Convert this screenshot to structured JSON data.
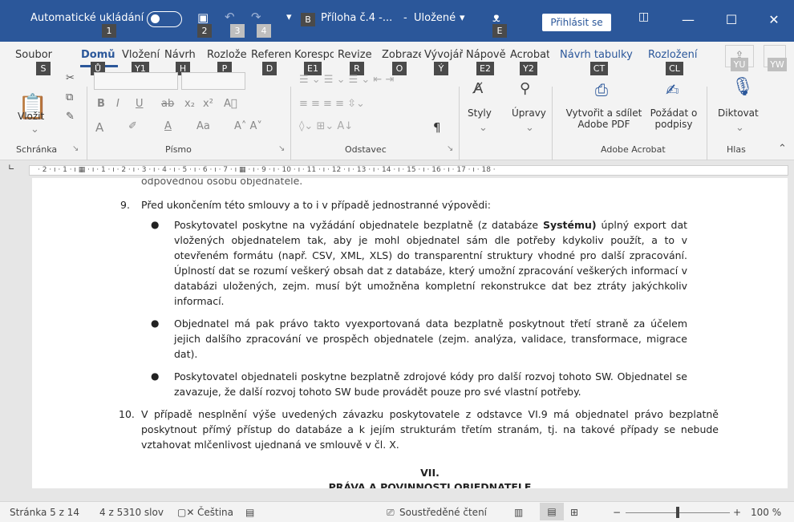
{
  "titlebar": {
    "autosave_label": "Automatické ukládání",
    "filename": "Příloha č.4 -...",
    "saved_status": "Uložené",
    "signin_label": "Přihlásit se",
    "keytips": [
      "1",
      "2",
      "3",
      "4",
      "B",
      "E"
    ]
  },
  "ribbon": {
    "tabs": [
      "Soubor",
      "Domů",
      "Vložení",
      "Návrh",
      "Rozložení",
      "Reference",
      "Korespondence",
      "Revize",
      "Zobrazení",
      "Vývojář",
      "Nápověda",
      "Acrobat",
      "Návrh tabulky",
      "Rozložení"
    ],
    "tab_keytips": [
      "S",
      "Ů",
      "Y1",
      "H",
      "P",
      "D",
      "E1",
      "R",
      "O",
      "Ý",
      "E2",
      "Y2",
      "CT",
      "CL",
      "YU",
      "YW"
    ],
    "clipboard": {
      "paste_label": "Vložit",
      "group_label": "Schránka"
    },
    "font": {
      "group_label": "Písmo",
      "bold": "B",
      "italic": "I",
      "underline": "U",
      "strike": "ab",
      "sub": "x₂",
      "sup": "x²",
      "aa": "Aa",
      "grow": "A˄ A˅"
    },
    "paragraph": {
      "group_label": "Odstavec",
      "pilcrow": "¶"
    },
    "styles": {
      "label": "Styly"
    },
    "editing": {
      "label": "Úpravy"
    },
    "acrobat": {
      "create_label": "Vytvořit a sdílet Adobe PDF",
      "sign_label": "Požádat o podpisy",
      "group_label": "Adobe Acrobat"
    },
    "voice": {
      "dictate_label": "Diktovat",
      "group_label": "Hlas"
    }
  },
  "ruler": {
    "text": "· 2 · ı · 1 · ı ▦ · ı · 1 · ı · 2 · ı · 3 · ı · 4 · ı · 5 · ı · 6 · ı · 7 · ı ▦ · ı · 9 · ı · 10 · ı · 11 · ı · 12 · ı · 13 · ı · 14 · ı · 15 · ı · 16 · ı · 17 · ı · 18 ·"
  },
  "document": {
    "cut_line": "odpovědnou osobu objednatele.",
    "item9_num": "9.",
    "item9_text": "Před ukončením této smlouvy a to i v případě jednostranné výpovědi:",
    "bullet1_a": "Poskytovatel poskytne na vyžádání objednatele bezplatně (z databáze ",
    "bullet1_bold": "Systému)",
    "bullet1_b": " úplný export dat vložených objednatelem tak, aby je mohl objednatel sám dle potřeby kdykoliv použít, a to v otevřeném formátu (např. CSV, XML, XLS) do transparentní struktury vhodné pro další zpracování. Úplností dat se rozumí veškerý obsah dat z databáze, který umožní zpracování veškerých informací v databázi uložených, zejm. musí být umožněna kompletní rekonstrukce dat bez ztráty jakýchkoliv informací.",
    "bullet2": "Objednatel má pak právo takto vyexportovaná data bezplatně poskytnout třetí straně za účelem jejich dalšího zpracování ve prospěch objednatele (zejm. analýza, validace, transformace, migrace dat).",
    "bullet3": "Poskytovatel objednateli poskytne bezplatně zdrojové kódy pro další rozvoj tohoto SW. Objednatel se zavazuje, že další rozvoj tohoto SW bude provádět pouze pro své vlastní potřeby.",
    "item10_num": "10.",
    "item10_text": "V případě nesplnění výše uvedených závazku poskytovatele z odstavce VI.9 má objednatel právo bezplatně poskytnout přímý přístup do databáze a k jejím strukturám třetím stranám, tj. na takové případy se nebude vztahovat mlčenlivost ujednaná ve smlouvě v čl. X.",
    "section_num": "VII.",
    "section_title": "PRÁVA A POVINNOSTI OBJEDNATELE"
  },
  "status": {
    "page": "Stránka 5 z 14",
    "words": "4 z 5310 slov",
    "language": "Čeština",
    "focus": "Soustředěné čtení",
    "zoom": "100 %",
    "zoom_minus": "−",
    "zoom_plus": "+"
  },
  "colors": {
    "brand": "#2b579a"
  }
}
